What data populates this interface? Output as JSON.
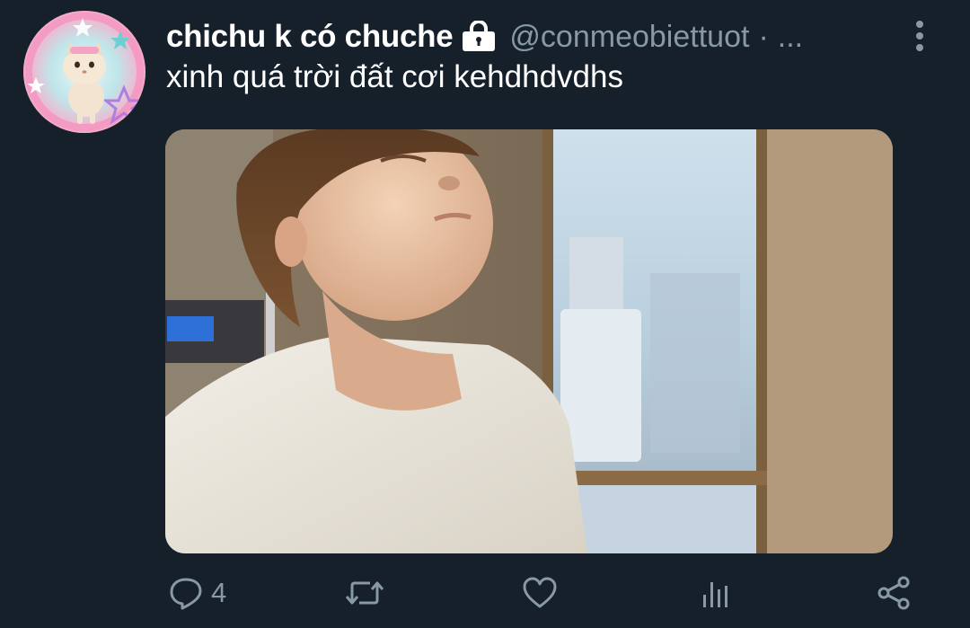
{
  "tweet": {
    "display_name": "chichu k có chuche",
    "handle": "@conmeobiettuot",
    "separator": "·",
    "truncation": "...",
    "text": "xinh quá trời đất cơi kehdhdvdhs",
    "protected_icon": "lock-icon",
    "more_icon": "vertical-ellipsis-icon"
  },
  "actions": {
    "reply": {
      "icon": "reply-icon",
      "count": "4"
    },
    "retweet": {
      "icon": "retweet-icon"
    },
    "like": {
      "icon": "heart-icon"
    },
    "analytics": {
      "icon": "analytics-icon"
    },
    "share": {
      "icon": "share-icon"
    }
  },
  "colors": {
    "background": "#15202b",
    "text_primary": "#ffffff",
    "text_secondary": "#8899a6",
    "avatar_ring": "#f3a9c8"
  }
}
